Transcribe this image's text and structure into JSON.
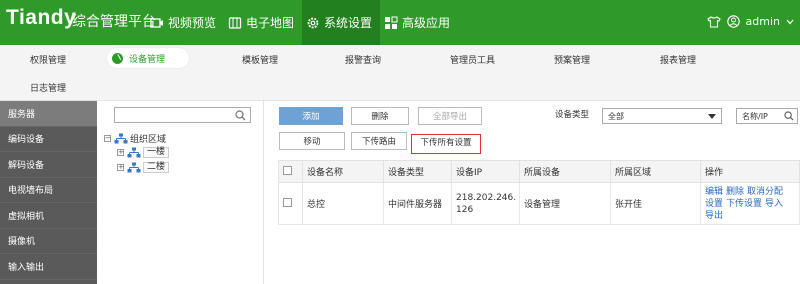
{
  "header": {
    "logo": "Tiandy",
    "app_title": "综合管理平台",
    "nav": [
      {
        "label": "视频预览",
        "icon": "video-icon"
      },
      {
        "label": "电子地图",
        "icon": "map-icon"
      },
      {
        "label": "系统设置",
        "icon": "gear-icon"
      },
      {
        "label": "高级应用",
        "icon": "grid-icon"
      }
    ],
    "user": "admin",
    "colors": {
      "brand": "#2f9a2a",
      "active_nav": "#23801f"
    }
  },
  "subnav": {
    "row1": [
      "权限管理",
      "设备管理",
      "模板管理",
      "报警查询",
      "管理员工具",
      "预案管理",
      "报表管理"
    ],
    "row2": [
      "日志管理"
    ],
    "active": "设备管理"
  },
  "sidebar": {
    "items": [
      "服务器",
      "编码设备",
      "解码设备",
      "电视墙布局",
      "虚拟相机",
      "摄像机",
      "输入输出"
    ],
    "active": "服务器"
  },
  "tree": {
    "search_placeholder": "",
    "root": "组织区域",
    "children": [
      "一楼",
      "二楼"
    ]
  },
  "toolbar": {
    "add": "添加",
    "delete": "删除",
    "export_all": "全部导出",
    "move": "移动",
    "push_route": "下传路由",
    "push_all_settings": "下传所有设置",
    "device_type_label": "设备类型",
    "device_type_value": "全部",
    "search_field_value": "名称/IP"
  },
  "table": {
    "columns": [
      "设备名称",
      "设备类型",
      "设备IP",
      "所属设备",
      "所属区域",
      "操作"
    ],
    "rows": [
      {
        "name": "总控",
        "type": "中间件服务器",
        "ip": "218.202.246.126",
        "parent": "设备管理",
        "area": "张开佳",
        "ops": [
          "编辑",
          "删除",
          "取消分配",
          "设置",
          "下传设置",
          "导入",
          "导出"
        ]
      }
    ]
  }
}
